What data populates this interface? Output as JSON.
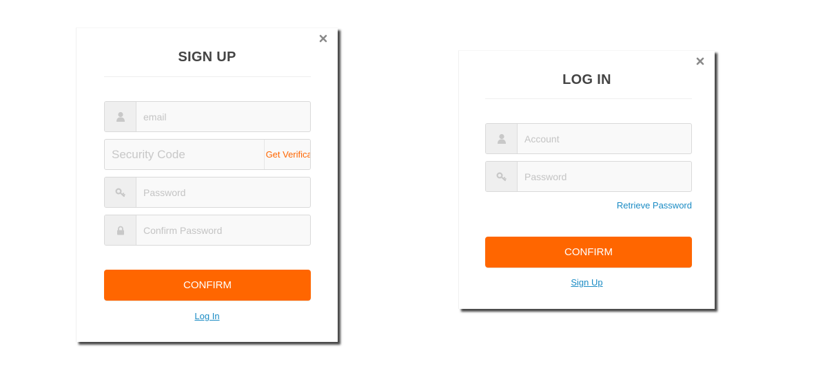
{
  "colors": {
    "accent": "#ff6600",
    "link": "#1a8bc4",
    "title": "#444444",
    "placeholder": "#c4c4c4",
    "icon": "#c8c8c8"
  },
  "signup": {
    "title": "SIGN UP",
    "close_icon": "close-icon",
    "email": {
      "icon": "user-icon",
      "placeholder": "email",
      "value": ""
    },
    "security_code": {
      "placeholder": "Security Code",
      "value": "",
      "get_code_label": "Get Verification Code"
    },
    "password": {
      "icon": "key-icon",
      "placeholder": "Password",
      "value": ""
    },
    "confirm_password": {
      "icon": "lock-icon",
      "placeholder": "Confirm Password",
      "value": ""
    },
    "confirm_label": "CONFIRM",
    "login_link": "Log In"
  },
  "login": {
    "title": "LOG IN",
    "close_icon": "close-icon",
    "account": {
      "icon": "user-icon",
      "placeholder": "Account",
      "value": ""
    },
    "password": {
      "icon": "key-icon",
      "placeholder": "Password",
      "value": ""
    },
    "retrieve_password": "Retrieve Password",
    "confirm_label": "CONFIRM",
    "signup_link": "Sign Up"
  }
}
